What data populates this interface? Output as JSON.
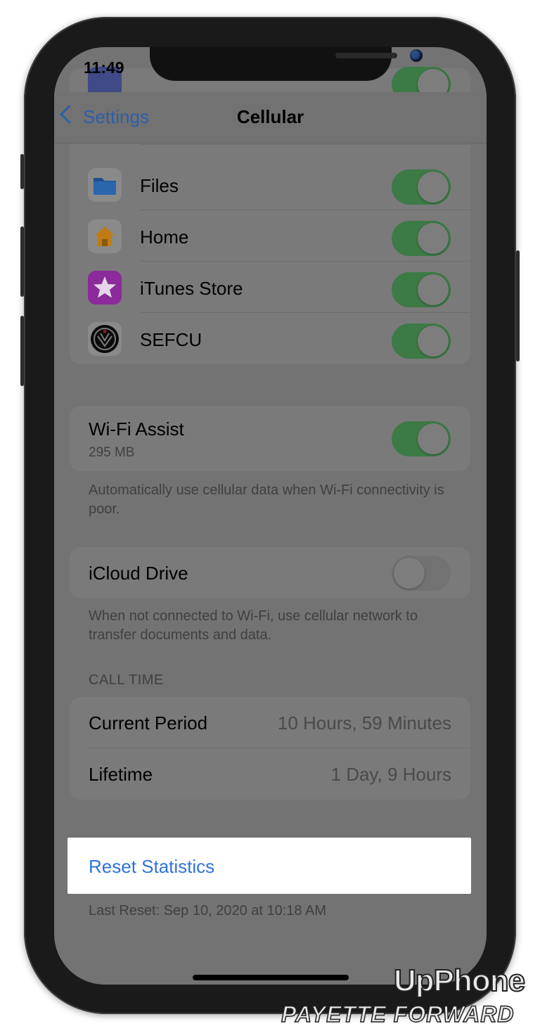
{
  "status_bar": {
    "time": "11:49"
  },
  "nav": {
    "back_label": "Settings",
    "title": "Cellular"
  },
  "apps": [
    {
      "name": "Files",
      "icon": "folder-icon",
      "enabled": true
    },
    {
      "name": "Home",
      "icon": "house-icon",
      "enabled": true
    },
    {
      "name": "iTunes Store",
      "icon": "star-icon",
      "enabled": true
    },
    {
      "name": "SEFCU",
      "icon": "sefcu-logo-icon",
      "enabled": true
    }
  ],
  "wifi_assist": {
    "label": "Wi-Fi Assist",
    "usage": "295 MB",
    "enabled": true,
    "footnote": "Automatically use cellular data when Wi-Fi connectivity is poor."
  },
  "icloud_drive": {
    "label": "iCloud Drive",
    "enabled": false,
    "footnote": "When not connected to Wi-Fi, use cellular network to transfer documents and data."
  },
  "call_time": {
    "header": "CALL TIME",
    "rows": [
      {
        "label": "Current Period",
        "value": "10 Hours, 59 Minutes"
      },
      {
        "label": "Lifetime",
        "value": "1 Day, 9 Hours"
      }
    ]
  },
  "reset": {
    "label": "Reset Statistics",
    "last_reset": "Last Reset: Sep 10, 2020 at 10:18 AM"
  },
  "colors": {
    "toggle_on": "#3c7a46",
    "link_blue": "#2f73dc",
    "dimmed_background": "#737373"
  },
  "watermark": {
    "line1": "UpPhone",
    "line2": "PAYETTE FORWARD"
  }
}
